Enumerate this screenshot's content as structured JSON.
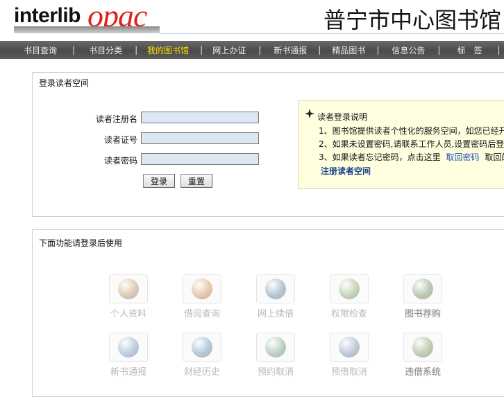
{
  "header": {
    "logo_word": "interlib",
    "logo_opac": "opac",
    "library_name": "普宁市中心图书馆"
  },
  "nav": {
    "items": [
      {
        "label": "书目查询",
        "active": false
      },
      {
        "label": "书目分类",
        "active": false
      },
      {
        "label": "我的图书馆",
        "active": true
      },
      {
        "label": "网上办证",
        "active": false
      },
      {
        "label": "新书通报",
        "active": false
      },
      {
        "label": "精品图书",
        "active": false
      },
      {
        "label": "信息公告",
        "active": false
      },
      {
        "label": "标　签",
        "active": false
      }
    ],
    "separator": "|"
  },
  "login": {
    "title": "登录读者空间",
    "fields": {
      "username_label": "读者注册名",
      "card_label": "读者证号",
      "password_label": "读者密码",
      "username_value": "",
      "card_value": "",
      "password_value": ""
    },
    "buttons": {
      "login": "登录",
      "reset": "重置"
    }
  },
  "help": {
    "title": "读者登录说明",
    "line1": "1、图书馆提供读者个性化的服务空间，如您已经开",
    "line2": "2、如果未设置密码,请联系工作人员,设置密码后登",
    "line3_prefix": "3、如果读者忘记密码，点击这里",
    "line3_link": "取回密码",
    "line3_suffix": "取回的",
    "register_link": "注册读者空间"
  },
  "functions": {
    "title": "下面功能请登录后使用",
    "items": [
      {
        "label": "个人资料",
        "color": "#c9a57a"
      },
      {
        "label": "借阅查询",
        "color": "#d9a06a"
      },
      {
        "label": "网上续借",
        "color": "#7f9ab0"
      },
      {
        "label": "权限检查",
        "color": "#9ab88a"
      },
      {
        "label": "图书荐购",
        "color": "#8aa070"
      },
      {
        "label": "新书通报",
        "color": "#8aa8c8"
      },
      {
        "label": "财经历史",
        "color": "#7aa0c0"
      },
      {
        "label": "预约取消",
        "color": "#8ab090"
      },
      {
        "label": "预借取消",
        "color": "#8aa0c0"
      },
      {
        "label": "违借系统",
        "color": "#90a878"
      }
    ]
  },
  "colors": {
    "accent_nav_active": "#ffe600",
    "logo_red": "#dd2222",
    "help_bg": "#ffffe0",
    "link_blue": "#1a56b0"
  }
}
